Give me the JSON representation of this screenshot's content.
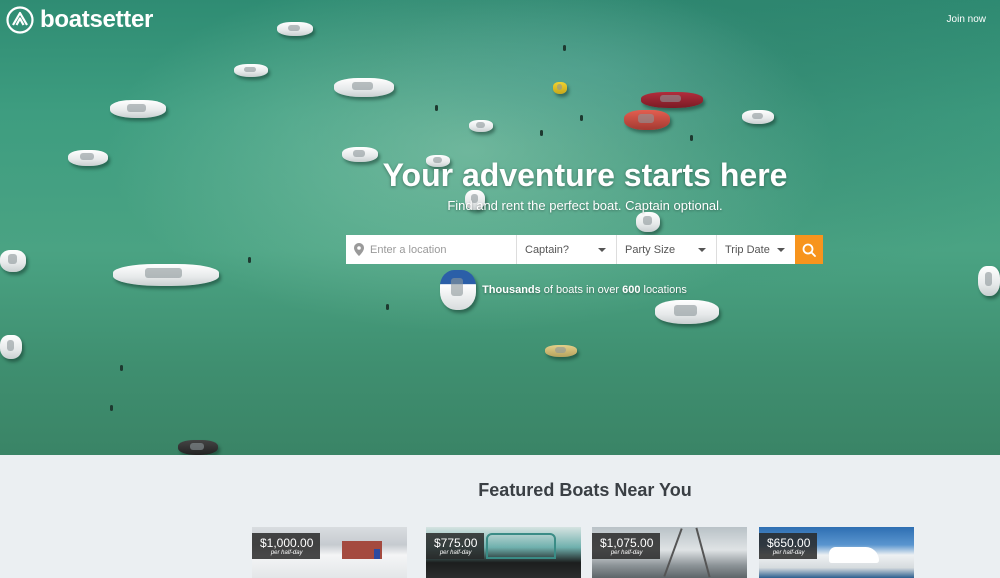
{
  "header": {
    "brand": "boatsetter",
    "join_label": "Join now"
  },
  "hero": {
    "headline": "Your adventure starts here",
    "subheadline": "Find and rent the perfect boat. Captain optional.",
    "search": {
      "location_placeholder": "Enter a location",
      "captain_label": "Captain?",
      "party_size_label": "Party Size",
      "trip_date_label": "Trip Date"
    },
    "stats": {
      "lead": "Thousands",
      "middle": " of boats in over ",
      "count": "600",
      "tail": " locations"
    }
  },
  "featured": {
    "title": "Featured Boats Near You",
    "boats": [
      {
        "price": "$1,000.00",
        "unit": "per half-day"
      },
      {
        "price": "$775.00",
        "unit": "per half-day"
      },
      {
        "price": "$1,075.00",
        "unit": "per half-day"
      },
      {
        "price": "$650.00",
        "unit": "per half-day"
      }
    ]
  },
  "colors": {
    "accent": "#f7941d",
    "water": "#4aa383",
    "section_bg": "#ebeff2"
  },
  "icons": [
    "logo-icon",
    "location-pin-icon",
    "chevron-down-icon",
    "search-icon"
  ]
}
